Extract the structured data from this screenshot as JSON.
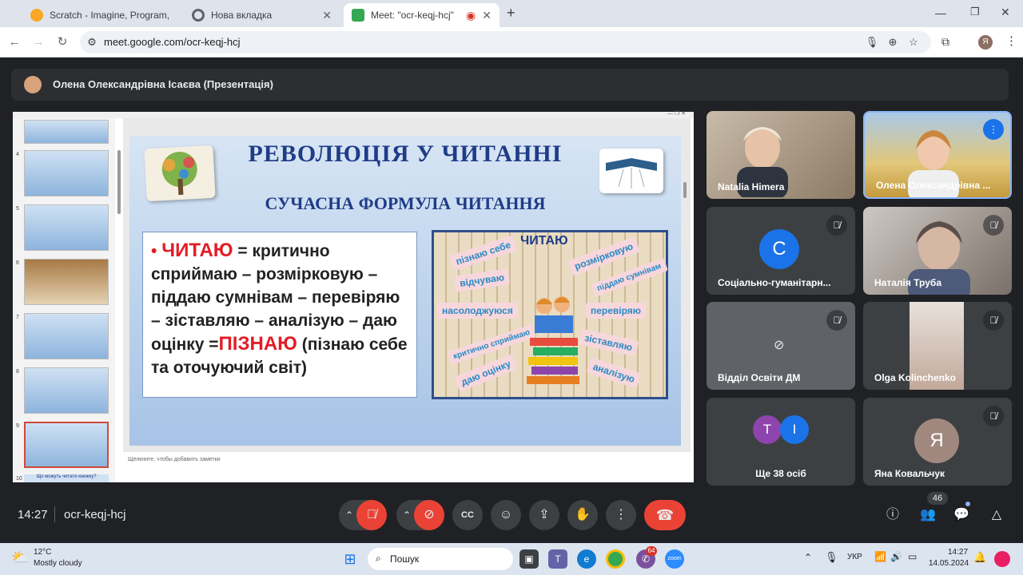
{
  "tabs": [
    {
      "title": "Scratch - Imagine, Program, Share",
      "color": "#f9a825"
    },
    {
      "title": "Нова вкладка",
      "color": "#5f6368"
    },
    {
      "title": "Meet: \"ocr-keqj-hcj\"",
      "color": "#34a853"
    }
  ],
  "address": {
    "url": "meet.google.com/ocr-keqj-hcj",
    "profile": "Я"
  },
  "presenter": {
    "title": "Олена Олександрівна Ісаєва (Презентація)"
  },
  "slides": {
    "numbers": [
      "4",
      "5",
      "6",
      "7",
      "8",
      "9",
      "10"
    ],
    "current": "9",
    "next_title": "Що можуть читати книжку?",
    "notes": "Щелкните, чтобы добавить заметки"
  },
  "slide": {
    "title": "РЕВОЛЮЦІЯ У ЧИТАННІ",
    "subtitle": "СУЧАСНА ФОРМУЛА ЧИТАННЯ",
    "bullet": "•",
    "word1": "ЧИТАЮ",
    "text1": " = критично сприймаю – розмірковую – піддаю сумнівам – перевіряю – зіставляю – аналізую – даю оцінку =",
    "word2": "ПІЗНАЮ",
    "text2": " (пізнаю себе та  оточуючий світ)",
    "image_title": "ЧИТАЮ",
    "labels": [
      "пізнаю себе",
      "розмірковую",
      "відчуваю",
      "піддаю сумнівам",
      "насолоджуюся",
      "перевіряю",
      "критично сприймаю",
      "зіставляю",
      "даю оцінку",
      "аналізую"
    ]
  },
  "participants": [
    {
      "name": "Natalia Himera",
      "type": "video",
      "bg": "#b39b86",
      "muted": false
    },
    {
      "name": "Олена Олександрівна ...",
      "type": "video",
      "bg": "#c9b06a",
      "muted": false,
      "speaking": true
    },
    {
      "name": "Соціально-гуманітарн...",
      "type": "avatar",
      "initial": "С",
      "avatar_color": "#1a73e8",
      "muted": true
    },
    {
      "name": "Наталія Труба",
      "type": "video",
      "bg": "#9a8f8c",
      "muted": true
    },
    {
      "name": "Відділ Освіти ДМ",
      "type": "camoff",
      "muted": true
    },
    {
      "name": "Olga Kolinchenko",
      "type": "video",
      "bg": "#8c7268",
      "muted": true
    },
    {
      "name": "Ще 38 осіб",
      "type": "group",
      "initials": [
        "T",
        "I"
      ],
      "colors": [
        "#8e44ad",
        "#1a73e8"
      ]
    },
    {
      "name": "Яна Ковальчук",
      "type": "avatar",
      "initial": "Я",
      "avatar_color": "#a1887f",
      "muted": true
    }
  ],
  "controls": {
    "time": "14:27",
    "code": "ocr-keqj-hcj",
    "people_count": "46",
    "end_color": "#ea4335"
  },
  "taskbar": {
    "temp": "12°C",
    "weather": "Mostly cloudy",
    "search": "Пошук",
    "lang": "УКР",
    "clock": "14:27",
    "date": "14.05.2024",
    "badge": "64"
  }
}
